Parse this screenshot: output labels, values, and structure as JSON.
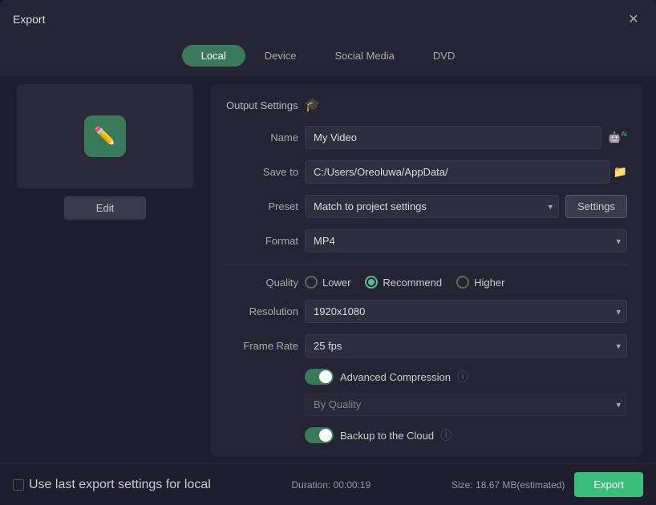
{
  "window": {
    "title": "Export",
    "close_label": "✕"
  },
  "tabs": [
    {
      "id": "local",
      "label": "Local",
      "active": true
    },
    {
      "id": "device",
      "label": "Device",
      "active": false
    },
    {
      "id": "social-media",
      "label": "Social Media",
      "active": false
    },
    {
      "id": "dvd",
      "label": "DVD",
      "active": false
    }
  ],
  "edit_button_label": "Edit",
  "output_settings": {
    "header": "Output Settings",
    "name_label": "Name",
    "name_value": "My Video",
    "save_to_label": "Save to",
    "save_to_value": "C:/Users/Oreoluwa/AppData/",
    "preset_label": "Preset",
    "preset_value": "Match to project settings",
    "settings_button_label": "Settings",
    "format_label": "Format",
    "format_value": "MP4",
    "quality_label": "Quality",
    "quality_options": [
      {
        "id": "lower",
        "label": "Lower",
        "selected": false
      },
      {
        "id": "recommend",
        "label": "Recommend",
        "selected": true
      },
      {
        "id": "higher",
        "label": "Higher",
        "selected": false
      }
    ],
    "resolution_label": "Resolution",
    "resolution_value": "1920x1080",
    "frame_rate_label": "Frame Rate",
    "frame_rate_value": "25 fps",
    "advanced_compression_label": "Advanced Compression",
    "advanced_compression_enabled": true,
    "by_quality_value": "By Quality",
    "backup_cloud_label": "Backup to the Cloud",
    "backup_cloud_enabled": true
  },
  "footer": {
    "use_last_settings_label": "Use last export settings for local",
    "duration_label": "Duration: 00:00:19",
    "size_label": "Size: 18.67 MB(estimated)",
    "export_button_label": "Export"
  },
  "icons": {
    "settings_hat": "🎓",
    "ai": "AI",
    "folder": "📁",
    "info": "ⓘ"
  }
}
